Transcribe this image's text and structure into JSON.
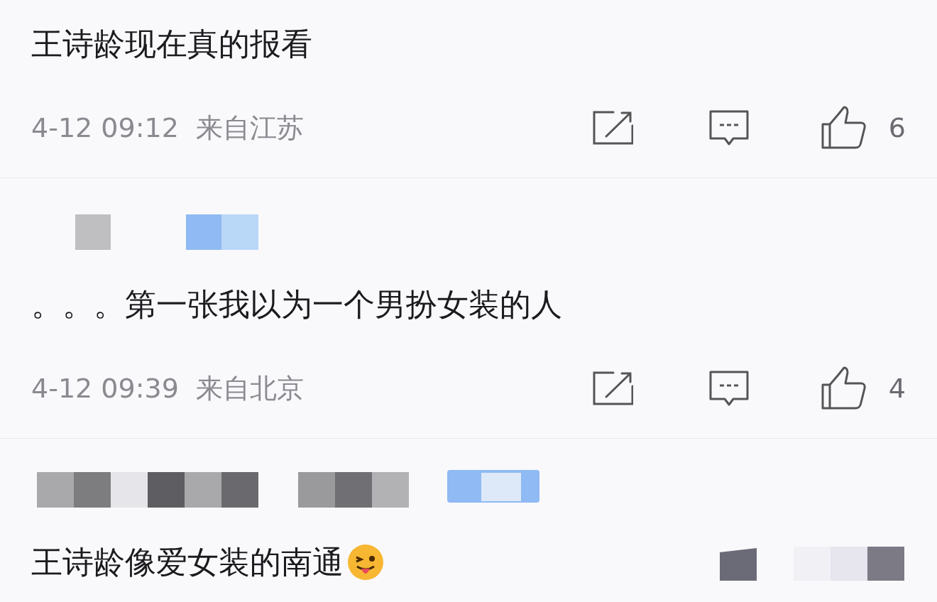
{
  "comments": [
    {
      "author_redacted": false,
      "text": "王诗龄现在真的报看",
      "emoji": false,
      "meta": {
        "time": "4-12 09:12",
        "location": "来自江苏",
        "likes": "6"
      }
    },
    {
      "author_redacted": true,
      "text": "。。。第一张我以为一个男扮女装的人",
      "emoji": false,
      "meta": {
        "time": "4-12 09:39",
        "location": "来自北京",
        "likes": "4"
      }
    },
    {
      "author_redacted": true,
      "text": "王诗龄像爱女装的南通",
      "emoji": true
    }
  ]
}
